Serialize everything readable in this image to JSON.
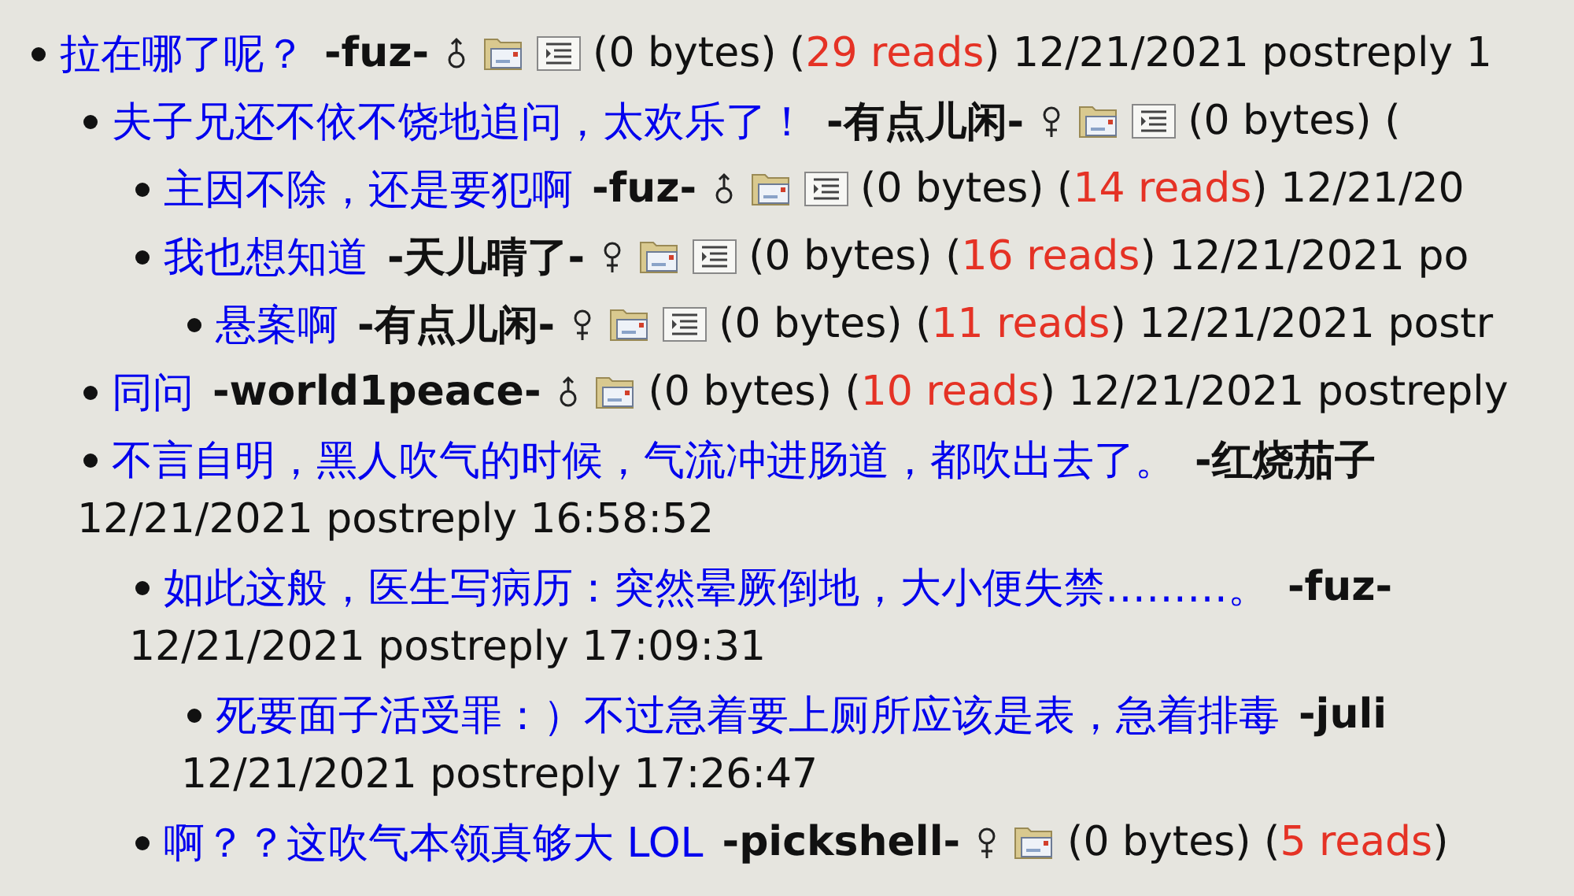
{
  "posts": [
    {
      "title": "拉在哪了呢？",
      "author": "-fuz-",
      "gender": {
        "kind": "male"
      },
      "icons": [
        {
          "kind": "mail"
        },
        {
          "kind": "text"
        }
      ],
      "meta": [
        {
          "kind": "plain",
          "text": "(0 bytes) ("
        },
        {
          "kind": "reads",
          "text": "29 reads"
        },
        {
          "kind": "plain",
          "text": ") 12/21/2021 postreply 1"
        }
      ],
      "children": [
        {
          "title": "夫子兄还不依不饶地追问，太欢乐了！",
          "author": "-有点儿闲-",
          "gender": {
            "kind": "female"
          },
          "icons": [
            {
              "kind": "mail"
            },
            {
              "kind": "text"
            }
          ],
          "meta": [
            {
              "kind": "plain",
              "text": "(0 bytes) ("
            }
          ],
          "children": [
            {
              "title": "主因不除，还是要犯啊",
              "author": "-fuz-",
              "gender": {
                "kind": "male"
              },
              "icons": [
                {
                  "kind": "mail"
                },
                {
                  "kind": "text"
                }
              ],
              "meta": [
                {
                  "kind": "plain",
                  "text": "(0 bytes) ("
                },
                {
                  "kind": "reads",
                  "text": "14 reads"
                },
                {
                  "kind": "plain",
                  "text": ") 12/21/20"
                }
              ]
            },
            {
              "title": "我也想知道",
              "author": "-天儿晴了-",
              "gender": {
                "kind": "female"
              },
              "icons": [
                {
                  "kind": "mail"
                },
                {
                  "kind": "text"
                }
              ],
              "meta": [
                {
                  "kind": "plain",
                  "text": "(0 bytes) ("
                },
                {
                  "kind": "reads",
                  "text": "16 reads"
                },
                {
                  "kind": "plain",
                  "text": ") 12/21/2021 po"
                }
              ],
              "children": [
                {
                  "title": "悬案啊",
                  "author": "-有点儿闲-",
                  "gender": {
                    "kind": "female"
                  },
                  "icons": [
                    {
                      "kind": "mail"
                    },
                    {
                      "kind": "text"
                    }
                  ],
                  "meta": [
                    {
                      "kind": "plain",
                      "text": "(0 bytes) ("
                    },
                    {
                      "kind": "reads",
                      "text": "11 reads"
                    },
                    {
                      "kind": "plain",
                      "text": ") 12/21/2021 postr"
                    }
                  ]
                }
              ]
            }
          ]
        },
        {
          "title": "同问",
          "author": "-world1peace-",
          "gender": {
            "kind": "male"
          },
          "icons": [
            {
              "kind": "mail"
            }
          ],
          "meta": [
            {
              "kind": "plain",
              "text": "(0 bytes) ("
            },
            {
              "kind": "reads",
              "text": "10 reads"
            },
            {
              "kind": "plain",
              "text": ") 12/21/2021 postreply"
            }
          ]
        },
        {
          "title": "不言自明，黑人吹气的时候，气流冲进肠道，都吹出去了。",
          "author": "-红烧茄子",
          "second_line": "12/21/2021 postreply 16:58:52",
          "children": [
            {
              "title": "如此这般，医生写病历：突然晕厥倒地，大小便失禁………。",
              "author": "-fuz-",
              "second_line": "12/21/2021 postreply 17:09:31",
              "children": [
                {
                  "title": "死要面子活受罪：）不过急着要上厕所应该是表，急着排毒",
                  "author": "-juli",
                  "second_line": "12/21/2021 postreply 17:26:47"
                }
              ]
            },
            {
              "title": "啊？？这吹气本领真够大 LOL",
              "author": "-pickshell-",
              "gender": {
                "kind": "female"
              },
              "icons": [
                {
                  "kind": "mail"
                }
              ],
              "meta": [
                {
                  "kind": "plain",
                  "text": "(0 bytes) ("
                },
                {
                  "kind": "reads",
                  "text": "5 reads"
                },
                {
                  "kind": "plain",
                  "text": ")"
                }
              ]
            }
          ]
        }
      ]
    }
  ]
}
